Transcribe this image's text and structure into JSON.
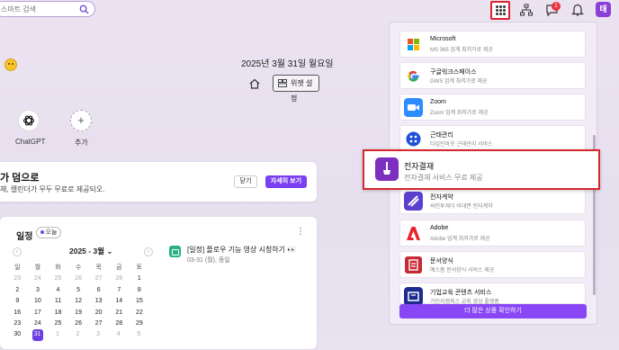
{
  "search": {
    "placeholder": "스마트 검색"
  },
  "header": {
    "message_count": "1",
    "avatar_letter": "태"
  },
  "home": {
    "date": "2025년 3월 31일 월요일",
    "widget_settings_label": "위젯 설정",
    "apps": [
      {
        "label": "ChatGPT",
        "icon": "chatgpt-icon"
      },
      {
        "label": "추가",
        "icon": "plus-icon"
      }
    ]
  },
  "promo": {
    "title": "가 덤으로",
    "description": "재, 캘린더가 무두 무료로 제공되오.",
    "close_label": "닫기",
    "detail_label": "자세히 보기"
  },
  "calendar": {
    "title": "일정",
    "today_label": "오늘",
    "month_label": "2025 - 3월",
    "weekdays": [
      "일",
      "월",
      "화",
      "수",
      "목",
      "금",
      "토"
    ],
    "weeks": [
      [
        "23",
        "24",
        "25",
        "26",
        "27",
        "28",
        "1"
      ],
      [
        "2",
        "3",
        "4",
        "5",
        "6",
        "7",
        "8"
      ],
      [
        "9",
        "10",
        "11",
        "12",
        "13",
        "14",
        "15"
      ],
      [
        "16",
        "17",
        "18",
        "19",
        "20",
        "21",
        "22"
      ],
      [
        "23",
        "24",
        "25",
        "26",
        "27",
        "28",
        "29"
      ],
      [
        "30",
        "31",
        "1",
        "2",
        "3",
        "4",
        "5"
      ]
    ],
    "selected_day": "31",
    "event": {
      "title": "[일정] 플로우 기능 영상 시청하기 👀",
      "time": "03-31 (월), 종일"
    }
  },
  "services": {
    "items": [
      {
        "name": "Microsoft",
        "desc": "MS 365 업계 최저가로 제공",
        "color": "#ffffff"
      },
      {
        "name": "구글워크스페이스",
        "desc": "GWS 업계 최저가로 제공",
        "color": "#ffffff"
      },
      {
        "name": "Zoom",
        "desc": "Zoom 업계 최저가로 제공",
        "color": "#2d8cff"
      },
      {
        "name": "근태관리",
        "desc": "타임인마웃 근태관리 서비스",
        "color": "#1f4fd8"
      },
      {
        "name": "전자결재",
        "desc": "전자결재 서비스 무료 제공",
        "color": "#7d2fc0"
      },
      {
        "name": "전자계약",
        "desc": "싸인투게더 비대면 전자계약",
        "color": "#5b3fd0"
      },
      {
        "name": "Adobe",
        "desc": "Adobe 업계 최저가로 제공",
        "color": "#e8232a"
      },
      {
        "name": "문서양식",
        "desc": "예스폼 문서양식 서비스 제공",
        "color": "#c62a35"
      },
      {
        "name": "기업교육 콘텐츠 서비스",
        "desc": "가인지캠퍼스 교육 영상 플랫폼",
        "color": "#1d2b8f"
      }
    ],
    "more_label": "더 많은 상품 확인하기"
  },
  "colors": {
    "accent": "#7a3ff0",
    "highlight_border": "#d7262e"
  }
}
